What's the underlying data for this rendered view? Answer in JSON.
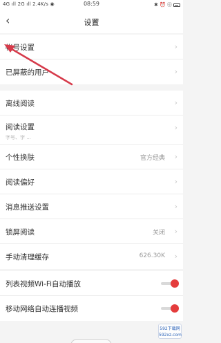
{
  "status_bar": {
    "network": "4G ıll 2G ıll 2.4K/s ◉",
    "time": "08:59",
    "icons": "✱ ⏰ ⓔ"
  },
  "nav": {
    "back_icon": "chevron-left",
    "title": "设置"
  },
  "group1": [
    {
      "label": "帐号设置"
    },
    {
      "label": "已屏蔽的用户"
    }
  ],
  "group2": [
    {
      "label": "离线阅读"
    },
    {
      "label": "阅读设置",
      "sub": "字号、字 ..."
    },
    {
      "label": "个性换肤",
      "value": "官方经典"
    },
    {
      "label": "阅读偏好"
    },
    {
      "label": "消息推送设置"
    },
    {
      "label": "锁屏阅读",
      "value": "关闭"
    },
    {
      "label": "手动清理缓存",
      "value": "626.30K"
    }
  ],
  "group3": [
    {
      "label": "列表视频Wi-Fi自动播放",
      "on": true
    },
    {
      "label": "移动网络自动连播视频",
      "on": true
    }
  ],
  "watermark": {
    "line1": "592下载网",
    "line2": "592xz.com"
  },
  "colors": {
    "accent": "#e43c3c",
    "arrow": "#d63a4a"
  }
}
